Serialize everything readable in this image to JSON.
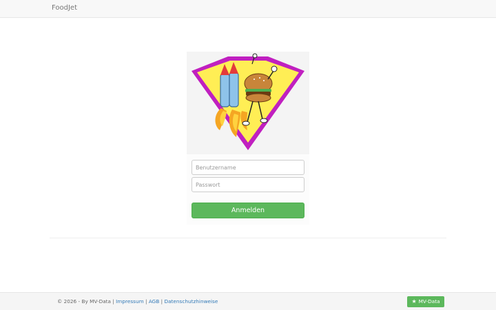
{
  "navbar": {
    "brand": "FoodJet"
  },
  "logo": {
    "name": "foodjet-logo",
    "colors": {
      "frame": "#c020c0",
      "fill": "#ffee55",
      "bun": "#c8853a",
      "jetpack": "#8ec3ea",
      "flame": "#f5a623",
      "rocket_tip": "#e33b3b"
    }
  },
  "login": {
    "username_placeholder": "Benutzername",
    "password_placeholder": "Passwort",
    "submit_label": "Anmelden"
  },
  "footer": {
    "copyright": "© 2026 - By MV-Data |",
    "links": {
      "impressum": "Impressum",
      "agb": "AGB",
      "datenschutz": "Datenschutzhinweise"
    },
    "separator": "|",
    "badge_label": "MV-Data",
    "badge_icon": "star-icon"
  },
  "colors": {
    "primary_green": "#5cb85c",
    "link_blue": "#337ab7",
    "navbar_bg": "#f8f8f8"
  }
}
